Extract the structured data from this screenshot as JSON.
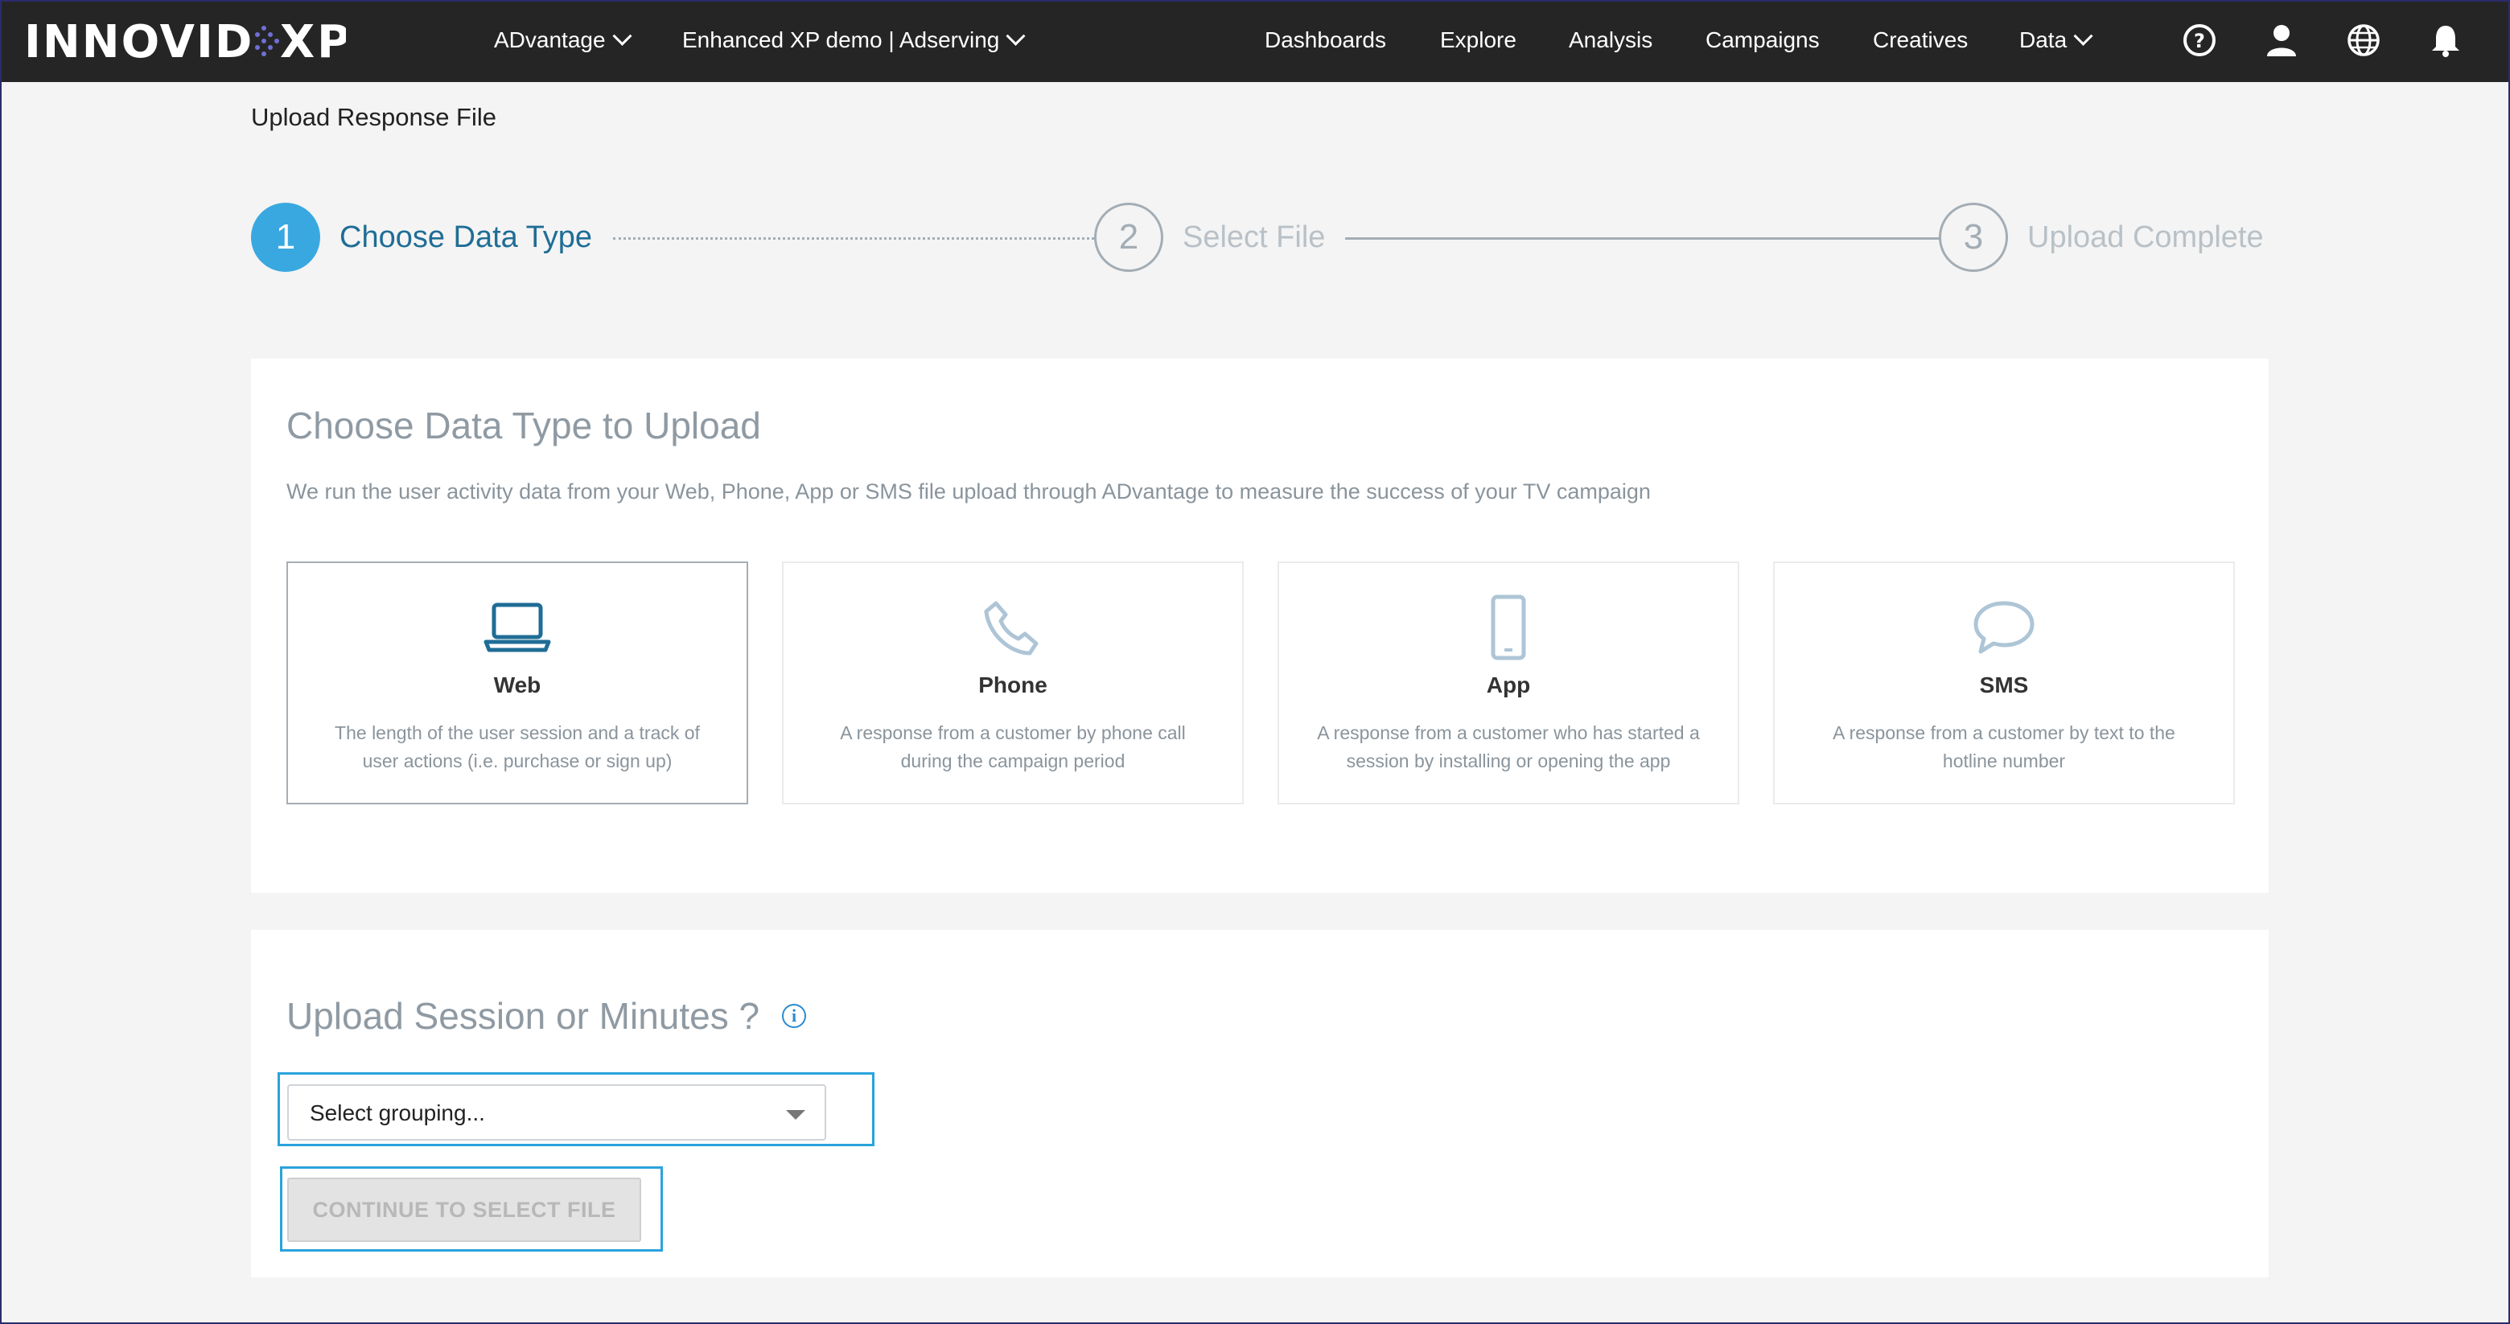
{
  "topbar": {
    "logo_text": "INNOVID XP",
    "account_dropdown": "ADvantage",
    "advertiser_dropdown": "Enhanced XP demo | Adserving",
    "links": [
      "Dashboards",
      "Explore",
      "Analysis",
      "Campaigns",
      "Creatives"
    ],
    "data_dropdown": "Data",
    "icons": [
      "help-icon",
      "user-icon",
      "globe-icon",
      "bell-icon"
    ]
  },
  "page": {
    "title": "Upload Response File"
  },
  "stepper": {
    "steps": [
      {
        "number": "1",
        "label": "Choose Data Type",
        "state": "active"
      },
      {
        "number": "2",
        "label": "Select File",
        "state": "inactive"
      },
      {
        "number": "3",
        "label": "Upload Complete",
        "state": "inactive"
      }
    ]
  },
  "data_type_panel": {
    "title": "Choose Data Type to Upload",
    "description": "We run the user activity data from your Web, Phone, App or SMS file upload through ADvantage to measure the success of your TV campaign",
    "cards": [
      {
        "name": "Web",
        "description": "The length of the user session and a track of user actions (i.e. purchase or sign up)",
        "icon": "laptop-icon",
        "selected": true
      },
      {
        "name": "Phone",
        "description": "A response from a customer by phone call during the campaign period",
        "icon": "phone-icon",
        "selected": false
      },
      {
        "name": "App",
        "description": "A response from a customer who has started a session by installing or opening the app",
        "icon": "mobile-icon",
        "selected": false
      },
      {
        "name": "SMS",
        "description": "A response from a customer by text to the hotline number",
        "icon": "chat-bubble-icon",
        "selected": false
      }
    ]
  },
  "grouping_panel": {
    "title": "Upload Session or Minutes ?",
    "select_value": "Select grouping...",
    "continue_label": "CONTINUE TO SELECT FILE"
  },
  "colors": {
    "accent": "#3aa8e0",
    "topbar": "#252525",
    "focus": "#2aa3dc",
    "icon_active": "#1f6d96",
    "icon_inactive": "#aec5d6"
  }
}
